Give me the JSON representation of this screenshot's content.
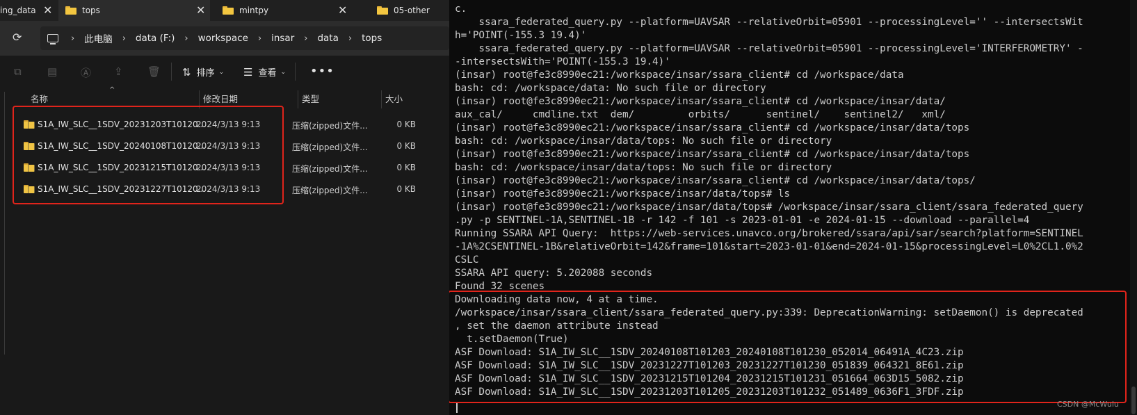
{
  "tabs": [
    {
      "label": "ing_data"
    },
    {
      "label": "tops"
    },
    {
      "label": "mintpy"
    },
    {
      "label": "05-other"
    }
  ],
  "breadcrumb": [
    "此电脑",
    "data (F:)",
    "workspace",
    "insar",
    "data",
    "tops"
  ],
  "toolbar": {
    "sort_label": "排序",
    "view_label": "查看"
  },
  "columns": {
    "name": "名称",
    "date": "修改日期",
    "type": "类型",
    "size": "大小"
  },
  "files": [
    {
      "name": "S1A_IW_SLC__1SDV_20231203T10120...",
      "date": "2024/3/13 9:13",
      "type": "压缩(zipped)文件...",
      "size": "0 KB"
    },
    {
      "name": "S1A_IW_SLC__1SDV_20240108T10120...",
      "date": "2024/3/13 9:13",
      "type": "压缩(zipped)文件...",
      "size": "0 KB"
    },
    {
      "name": "S1A_IW_SLC__1SDV_20231215T10120...",
      "date": "2024/3/13 9:13",
      "type": "压缩(zipped)文件...",
      "size": "0 KB"
    },
    {
      "name": "S1A_IW_SLC__1SDV_20231227T10120...",
      "date": "2024/3/13 9:13",
      "type": "压缩(zipped)文件...",
      "size": "0 KB"
    }
  ],
  "terminal": {
    "lines": [
      "c.",
      "    ssara_federated_query.py --platform=UAVSAR --relativeOrbit=05901 --processingLevel='' --intersectsWit",
      "h='POINT(-155.3 19.4)'",
      "    ssara_federated_query.py --platform=UAVSAR --relativeOrbit=05901 --processingLevel='INTERFEROMETRY' -",
      "-intersectsWith='POINT(-155.3 19.4)'",
      "(insar) root@fe3c8990ec21:/workspace/insar/ssara_client# cd /workspace/data",
      "bash: cd: /workspace/data: No such file or directory",
      "(insar) root@fe3c8990ec21:/workspace/insar/ssara_client# cd /workspace/insar/data/",
      "aux_cal/     cmdline.txt  dem/         orbits/      sentinel/    sentinel2/   xml/",
      "(insar) root@fe3c8990ec21:/workspace/insar/ssara_client# cd /workspace/insar/data/tops",
      "bash: cd: /workspace/insar/data/tops: No such file or directory",
      "(insar) root@fe3c8990ec21:/workspace/insar/ssara_client# cd /workspace/insar/data/tops",
      "bash: cd: /workspace/insar/data/tops: No such file or directory",
      "(insar) root@fe3c8990ec21:/workspace/insar/ssara_client# cd /workspace/insar/data/tops/",
      "(insar) root@fe3c8990ec21:/workspace/insar/data/tops# ls",
      "(insar) root@fe3c8990ec21:/workspace/insar/data/tops# /workspace/insar/ssara_client/ssara_federated_query",
      ".py -p SENTINEL-1A,SENTINEL-1B -r 142 -f 101 -s 2023-01-01 -e 2024-01-15 --download --parallel=4",
      "Running SSARA API Query:  https://web-services.unavco.org/brokered/ssara/api/sar/search?platform=SENTINEL",
      "-1A%2CSENTINEL-1B&relativeOrbit=142&frame=101&start=2023-01-01&end=2024-01-15&processingLevel=L0%2CL1.0%2",
      "CSLC",
      "SSARA API query: 5.202088 seconds",
      "Found 32 scenes",
      "Downloading data now, 4 at a time.",
      "/workspace/insar/ssara_client/ssara_federated_query.py:339: DeprecationWarning: setDaemon() is deprecated",
      ", set the daemon attribute instead",
      "  t.setDaemon(True)",
      "ASF Download: S1A_IW_SLC__1SDV_20240108T101203_20240108T101230_052014_06491A_4C23.zip",
      "ASF Download: S1A_IW_SLC__1SDV_20231227T101203_20231227T101230_051839_064321_8E61.zip",
      "ASF Download: S1A_IW_SLC__1SDV_20231215T101204_20231215T101231_051664_063D15_5082.zip",
      "ASF Download: S1A_IW_SLC__1SDV_20231203T101205_20231203T101232_051489_0636F1_3FDF.zip"
    ]
  },
  "watermark": "CSDN @McWulu",
  "colors": {
    "highlight_border": "#e0241b",
    "folder": "#f3c640",
    "terminal_bg": "#0c0c0c",
    "explorer_bg": "#191919"
  }
}
